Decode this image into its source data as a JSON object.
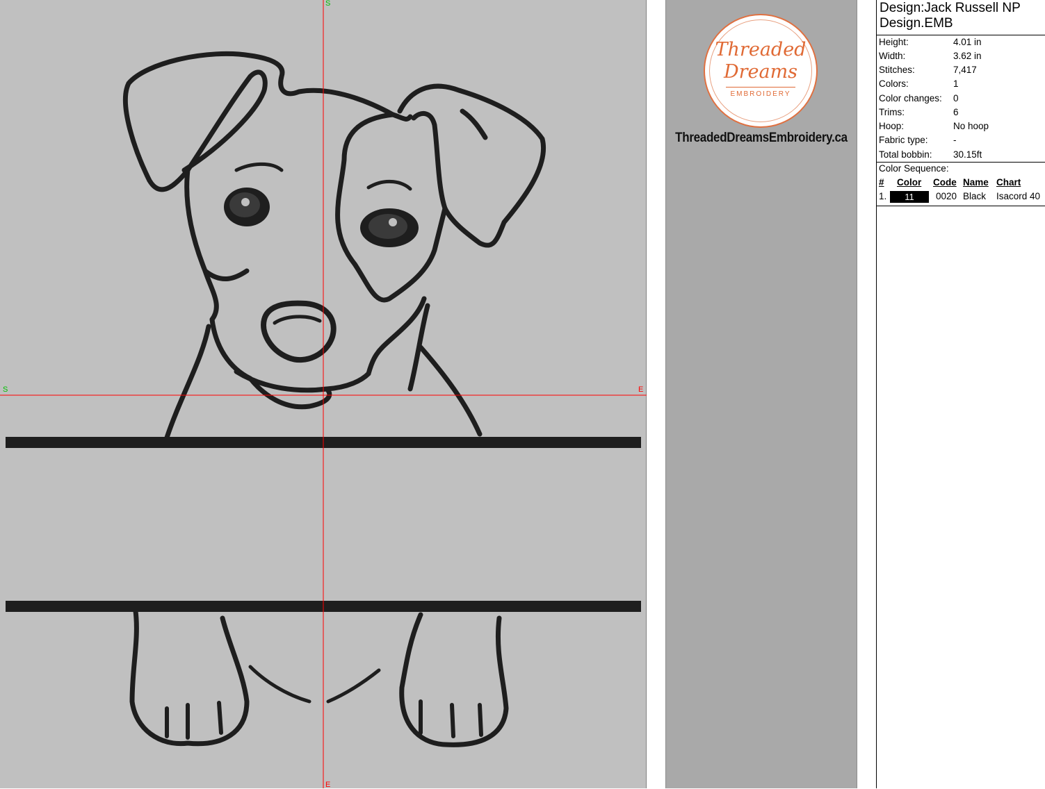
{
  "canvas": {
    "background": "#c0c0c0",
    "crosshair_color": "#ff0000",
    "marker_color": "#00c000",
    "thread_color": "#1e1e1e",
    "markers": {
      "top": "S",
      "left": "S",
      "right": "E",
      "bottom": "E"
    }
  },
  "logo": {
    "line1": "Threaded",
    "line2": "Dreams",
    "line3": "EMBROIDERY",
    "website": "ThreadedDreamsEmbroidery.ca",
    "accent": "#e06a35"
  },
  "info": {
    "title_line1": "Design:Jack Russell NP",
    "title_line2": "Design.EMB",
    "stats": [
      {
        "label": "Height:",
        "value": "4.01 in"
      },
      {
        "label": "Width:",
        "value": "3.62 in"
      },
      {
        "label": "Stitches:",
        "value": "7,417"
      },
      {
        "label": "Colors:",
        "value": "1"
      },
      {
        "label": "Color changes:",
        "value": "0"
      },
      {
        "label": "Trims:",
        "value": "6"
      },
      {
        "label": "Hoop:",
        "value": "No hoop"
      },
      {
        "label": "Fabric type:",
        "value": "-"
      },
      {
        "label": "Total bobbin:",
        "value": "30.15ft"
      }
    ],
    "color_sequence_label": "Color Sequence:",
    "columns": {
      "num": "#",
      "color": "Color",
      "code": "Code",
      "name": "Name",
      "chart": "Chart"
    },
    "colors": [
      {
        "num": "1.",
        "swatch": "11",
        "swatch_color": "#000000",
        "code": "0020",
        "name": "Black",
        "chart": "Isacord 40"
      }
    ]
  }
}
